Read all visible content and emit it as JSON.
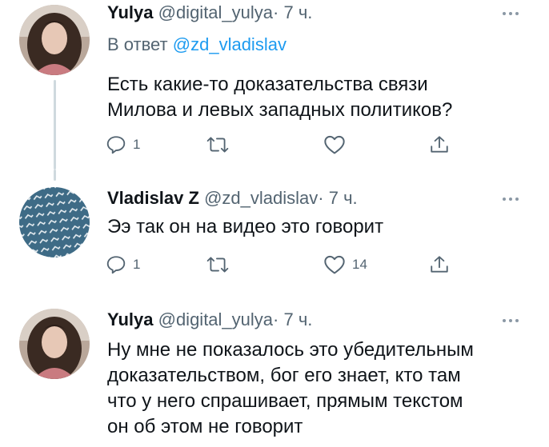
{
  "tweets": [
    {
      "name": "Yulya",
      "handle": "@digital_yulya",
      "dot": "·",
      "time": "7 ч.",
      "reply_prefix": "В ответ",
      "reply_mention": "@zd_vladislav",
      "text_lines": [
        "Есть какие-то доказательства связи",
        "Милова и левых западных политиков?"
      ],
      "reply_count": "1",
      "retweet_count": "",
      "like_count": ""
    },
    {
      "name": "Vladislav Z",
      "handle": "@zd_vladislav",
      "dot": "·",
      "time": "7 ч.",
      "text_lines": [
        "Ээ так он на видео это говорит"
      ],
      "reply_count": "1",
      "retweet_count": "",
      "like_count": "14"
    },
    {
      "name": "Yulya",
      "handle": "@digital_yulya",
      "dot": "·",
      "time": "7 ч.",
      "text_lines": [
        "Ну мне не показалось это убедительным",
        "доказательством, бог его знает, кто там",
        "что у него спрашивает, прямым текстом",
        "он об этом не говорит"
      ]
    }
  ],
  "icons": {
    "reply": "reply-icon",
    "retweet": "retweet-icon",
    "like": "heart-icon",
    "share": "share-icon",
    "more": "more-dots-icon"
  },
  "colors": {
    "text": "#0f1419",
    "secondary": "#536471",
    "link": "#1d9bf0",
    "thread_line": "#cfd9de"
  }
}
